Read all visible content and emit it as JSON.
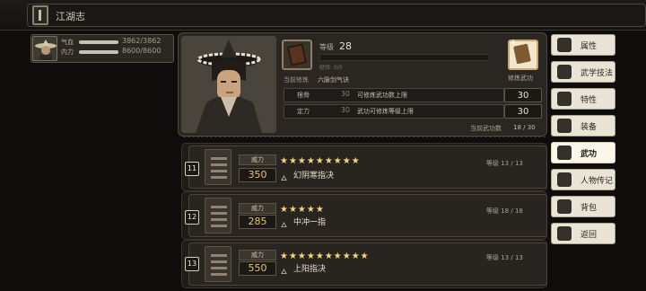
{
  "header": {
    "title": "江湖志"
  },
  "character": {
    "hp_label": "气血",
    "hp_value": "3862/3862",
    "mp_label": "内力",
    "mp_value": "8600/8600"
  },
  "main": {
    "level_label": "等级",
    "level_value": "28",
    "exp_label": "经验: 0/0",
    "current_practice_label": "当前修炼",
    "current_practice_value": "六脉剑气诀",
    "practice_label": "修炼武功",
    "rows": [
      {
        "label": "根骨",
        "num": "30",
        "desc": "可修炼武功数上限",
        "value": "30"
      },
      {
        "label": "定力",
        "num": "30",
        "desc": "武功可修炼等级上限",
        "value": "30"
      }
    ],
    "total_label": "当前武功数",
    "total_value": "18 / 30"
  },
  "skills": [
    {
      "index": "11",
      "power_label": "威力",
      "power": "350",
      "stars": "★★★★★★★★★",
      "name": "幻阴寒指决",
      "level": "等级 13 / 13"
    },
    {
      "index": "12",
      "power_label": "威力",
      "power": "285",
      "stars": "★★★★★",
      "name": "中冲一指",
      "level": "等级 18 / 18"
    },
    {
      "index": "13",
      "power_label": "威力",
      "power": "550",
      "stars": "★★★★★★★★★★",
      "name": "上阳指决",
      "level": "等级 13 / 13"
    }
  ],
  "tabs": [
    {
      "label": "属性",
      "icon": "person-icon"
    },
    {
      "label": "武学技法",
      "icon": "martial-art-icon"
    },
    {
      "label": "特性",
      "icon": "trait-icon"
    },
    {
      "label": "装备",
      "icon": "sword-icon"
    },
    {
      "label": "武功",
      "icon": "book-icon"
    },
    {
      "label": "人物传记",
      "icon": "biography-icon"
    },
    {
      "label": "背包",
      "icon": "bag-icon"
    },
    {
      "label": "返回",
      "icon": "return-icon"
    }
  ],
  "active_tab": "武功"
}
